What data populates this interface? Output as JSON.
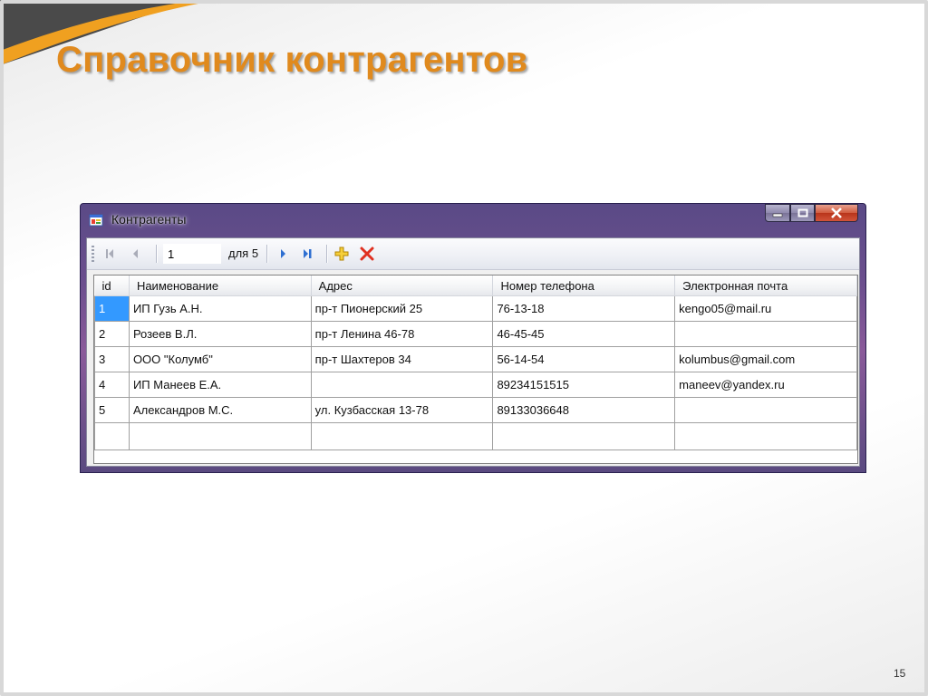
{
  "slide": {
    "title": "Справочник контрагентов",
    "page_number": "15"
  },
  "window": {
    "title": "Контрагенты",
    "icons": {
      "app": "form-app-icon",
      "minimize": "minimize-icon",
      "maximize": "maximize-icon",
      "close": "close-icon"
    }
  },
  "navigator": {
    "position": "1",
    "count_label": "для 5",
    "icons": {
      "first": "move-first-icon",
      "previous": "move-previous-icon",
      "next": "move-next-icon",
      "last": "move-last-icon",
      "add": "add-new-icon",
      "delete": "delete-icon"
    },
    "colors": {
      "nav": "#2e6fd1",
      "add": "#e8b400",
      "delete": "#e03020"
    }
  },
  "grid": {
    "columns": [
      "id",
      "Наименование",
      "Адрес",
      "Номер телефона",
      "Электронная почта"
    ],
    "rows": [
      {
        "id": "1",
        "name": "ИП Гузь А.Н.",
        "address": "пр-т Пионерский 25",
        "phone": "76-13-18",
        "email": "kengo05@mail.ru"
      },
      {
        "id": "2",
        "name": "Розеев В.Л.",
        "address": "пр-т Ленина 46-78",
        "phone": "46-45-45",
        "email": ""
      },
      {
        "id": "3",
        "name": "ООО \"Колумб\"",
        "address": "пр-т Шахтеров 34",
        "phone": "56-14-54",
        "email": "kolumbus@gmail.com"
      },
      {
        "id": "4",
        "name": "ИП Манеев Е.А.",
        "address": "",
        "phone": "89234151515",
        "email": "maneev@yandex.ru"
      },
      {
        "id": "5",
        "name": "Александров М.С.",
        "address": "ул. Кузбасская 13-78",
        "phone": "89133036648",
        "email": ""
      }
    ],
    "selected_color": "#3399ff"
  }
}
